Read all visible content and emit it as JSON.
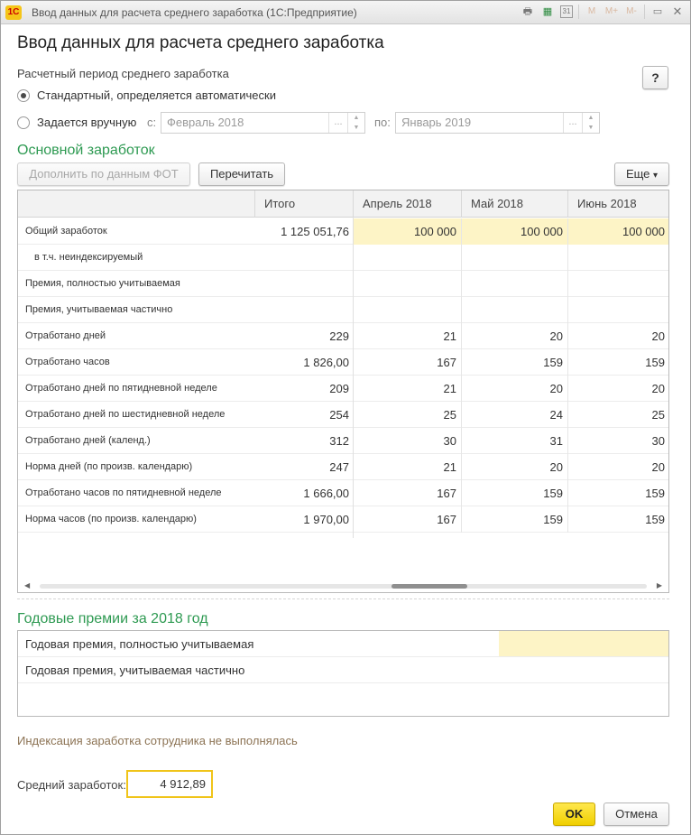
{
  "window": {
    "app_logo": "1С",
    "title": "Ввод данных для расчета среднего заработка  (1С:Предприятие)",
    "toolbar_icons": [
      "print-icon",
      "calculator-icon",
      "calendar-icon",
      "memory-m-icon",
      "memory-mplus-icon",
      "memory-mminus-icon",
      "minimize-icon",
      "close-icon"
    ],
    "calendar_day": "31",
    "m_labels": [
      "M",
      "M+",
      "M-"
    ],
    "minimize_glyph": "▭",
    "close_glyph": "✕"
  },
  "form": {
    "title": "Ввод данных для расчета среднего заработка",
    "help_label": "?"
  },
  "period": {
    "label": "Расчетный период среднего заработка",
    "option_auto": "Стандартный, определяется автоматически",
    "option_manual": "Задается вручную",
    "selected": "auto",
    "from_label": "с:",
    "from_value": "Февраль 2018",
    "to_label": "по:",
    "to_value": "Январь 2019",
    "choose_glyph": "...",
    "spin_up": "▲",
    "spin_down": "▼"
  },
  "earnings": {
    "title": "Основной заработок",
    "btn_fill": "Дополнить по данным ФОТ",
    "btn_recalc": "Перечитать",
    "btn_more": "Еще",
    "more_arrow": "▾",
    "headers": [
      "",
      "Итого",
      "Апрель 2018",
      "Май 2018",
      "Июнь 2018"
    ],
    "rows": [
      {
        "label": "Общий заработок",
        "total": "1 125 051,76",
        "m1": "100 000",
        "m2": "100 000",
        "m3": "100 000",
        "hl": true
      },
      {
        "label": "в т.ч. неиндексируемый",
        "total": "",
        "m1": "",
        "m2": "",
        "m3": "",
        "indent": true
      },
      {
        "label": "Премия, полностью учитываемая",
        "total": "",
        "m1": "",
        "m2": "",
        "m3": ""
      },
      {
        "label": "Премия, учитываемая частично",
        "total": "",
        "m1": "",
        "m2": "",
        "m3": ""
      },
      {
        "label": "Отработано дней",
        "total": "229",
        "m1": "21",
        "m2": "20",
        "m3": "20"
      },
      {
        "label": "Отработано часов",
        "total": "1 826,00",
        "m1": "167",
        "m2": "159",
        "m3": "159"
      },
      {
        "label": "Отработано дней по пятидневной неделе",
        "total": "209",
        "m1": "21",
        "m2": "20",
        "m3": "20"
      },
      {
        "label": "Отработано дней по шестидневной неделе",
        "total": "254",
        "m1": "25",
        "m2": "24",
        "m3": "25"
      },
      {
        "label": "Отработано дней (календ.)",
        "total": "312",
        "m1": "30",
        "m2": "31",
        "m3": "30"
      },
      {
        "label": "Норма дней (по произв. календарю)",
        "total": "247",
        "m1": "21",
        "m2": "20",
        "m3": "20"
      },
      {
        "label": "Отработано часов по пятидневной неделе",
        "total": "1 666,00",
        "m1": "167",
        "m2": "159",
        "m3": "159"
      },
      {
        "label": "Норма часов (по произв. календарю)",
        "total": "1 970,00",
        "m1": "167",
        "m2": "159",
        "m3": "159"
      }
    ],
    "scroll_left": "◀",
    "scroll_right": "▶"
  },
  "bonuses": {
    "title": "Годовые премии за 2018 год",
    "rows": [
      {
        "label": "Годовая премия, полностью учитываемая",
        "value": ""
      },
      {
        "label": "Годовая премия, учитываемая частично",
        "value": ""
      }
    ]
  },
  "indexation_note": "Индексация заработка сотрудника не выполнялась",
  "average": {
    "label": "Средний заработок:",
    "value": "4 912,89"
  },
  "footer": {
    "ok": "OK",
    "cancel": "Отмена"
  }
}
